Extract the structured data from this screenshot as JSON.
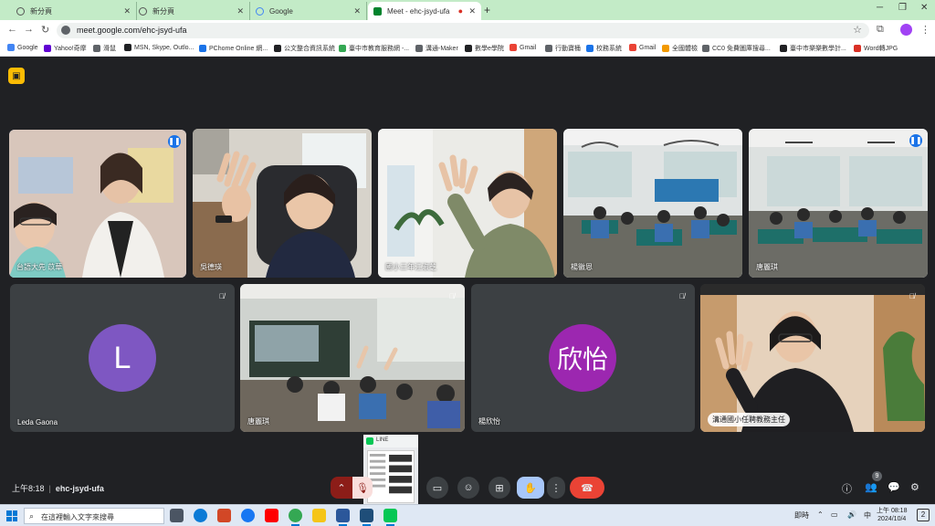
{
  "browser": {
    "tabs": [
      {
        "title": "新分頁",
        "active": false
      },
      {
        "title": "新分頁",
        "active": false
      },
      {
        "title": "Google",
        "active": false
      },
      {
        "title": "Meet - ehc-jsyd-ufa",
        "active": true
      }
    ],
    "new_tab_symbol": "+",
    "url": "meet.google.com/ehc-jsyd-ufa",
    "bookmarks": [
      {
        "label": "Google",
        "color": "#4285f4"
      },
      {
        "label": "Yahoo!奇摩",
        "color": "#6001d2"
      },
      {
        "label": "滑鼠",
        "color": "#5f6368"
      },
      {
        "label": "MSN, Skype, Outlo...",
        "color": "#202124"
      },
      {
        "label": "PChome Online 網...",
        "color": "#1a73e8"
      },
      {
        "label": "公文整合資訊系統",
        "color": "#202124"
      },
      {
        "label": "臺中市教育服務網 -...",
        "color": "#34a853"
      },
      {
        "label": "溝通-Maker",
        "color": "#5f6368"
      },
      {
        "label": "數學e學院",
        "color": "#202124"
      },
      {
        "label": "Gmail",
        "color": "#ea4335"
      },
      {
        "label": "行動寶桶",
        "color": "#5f6368"
      },
      {
        "label": "校務系統",
        "color": "#1a73e8"
      },
      {
        "label": "Gmail",
        "color": "#ea4335"
      },
      {
        "label": "全國體檢",
        "color": "#f29900"
      },
      {
        "label": "CC0 免費圖庫搜尋...",
        "color": "#5f6368"
      },
      {
        "label": "臺中市樂樂數學計...",
        "color": "#202124"
      },
      {
        "label": "Word轉JPG",
        "color": "#d93025"
      }
    ]
  },
  "meet": {
    "participants": [
      {
        "name": "台語大先 苡華",
        "initial": "",
        "avatar_color": "",
        "speaking": true,
        "indicator": "wave"
      },
      {
        "name": "吳德瑛",
        "initial": "",
        "avatar_color": "",
        "speaking": false,
        "indicator": ""
      },
      {
        "name": "國小三年江淑芝",
        "initial": "",
        "avatar_color": "",
        "speaking": false,
        "indicator": ""
      },
      {
        "name": "楊徽恩",
        "initial": "",
        "avatar_color": "",
        "speaking": false,
        "indicator": ""
      },
      {
        "name": "唐麗琪",
        "initial": "",
        "avatar_color": "",
        "speaking": false,
        "indicator": "wave"
      },
      {
        "name": "Leda Gaona",
        "initial": "L",
        "avatar_color": "#7e57c2",
        "speaking": false,
        "indicator": "mute"
      },
      {
        "name": "唐麗琪",
        "initial": "",
        "avatar_color": "",
        "speaking": false,
        "indicator": "mute"
      },
      {
        "name": "楊欣怡",
        "initial": "欣怡",
        "avatar_color": "#9c27b0",
        "speaking": false,
        "indicator": "mute"
      },
      {
        "name": "溝通國小任聘教務主任",
        "initial": "",
        "avatar_color": "",
        "speaking": false,
        "indicator": "mute"
      }
    ],
    "pip": {
      "label": "LINE"
    },
    "time": "上午8:18",
    "meeting_code": "ehc-jsyd-ufa",
    "people_count": "9"
  },
  "taskbar": {
    "search_placeholder": "在這裡輸入文字來搜尋",
    "tray_text": "即時",
    "ime": "中",
    "time": "上午 08:18",
    "date": "2024/10/4",
    "notif_count": "2"
  }
}
